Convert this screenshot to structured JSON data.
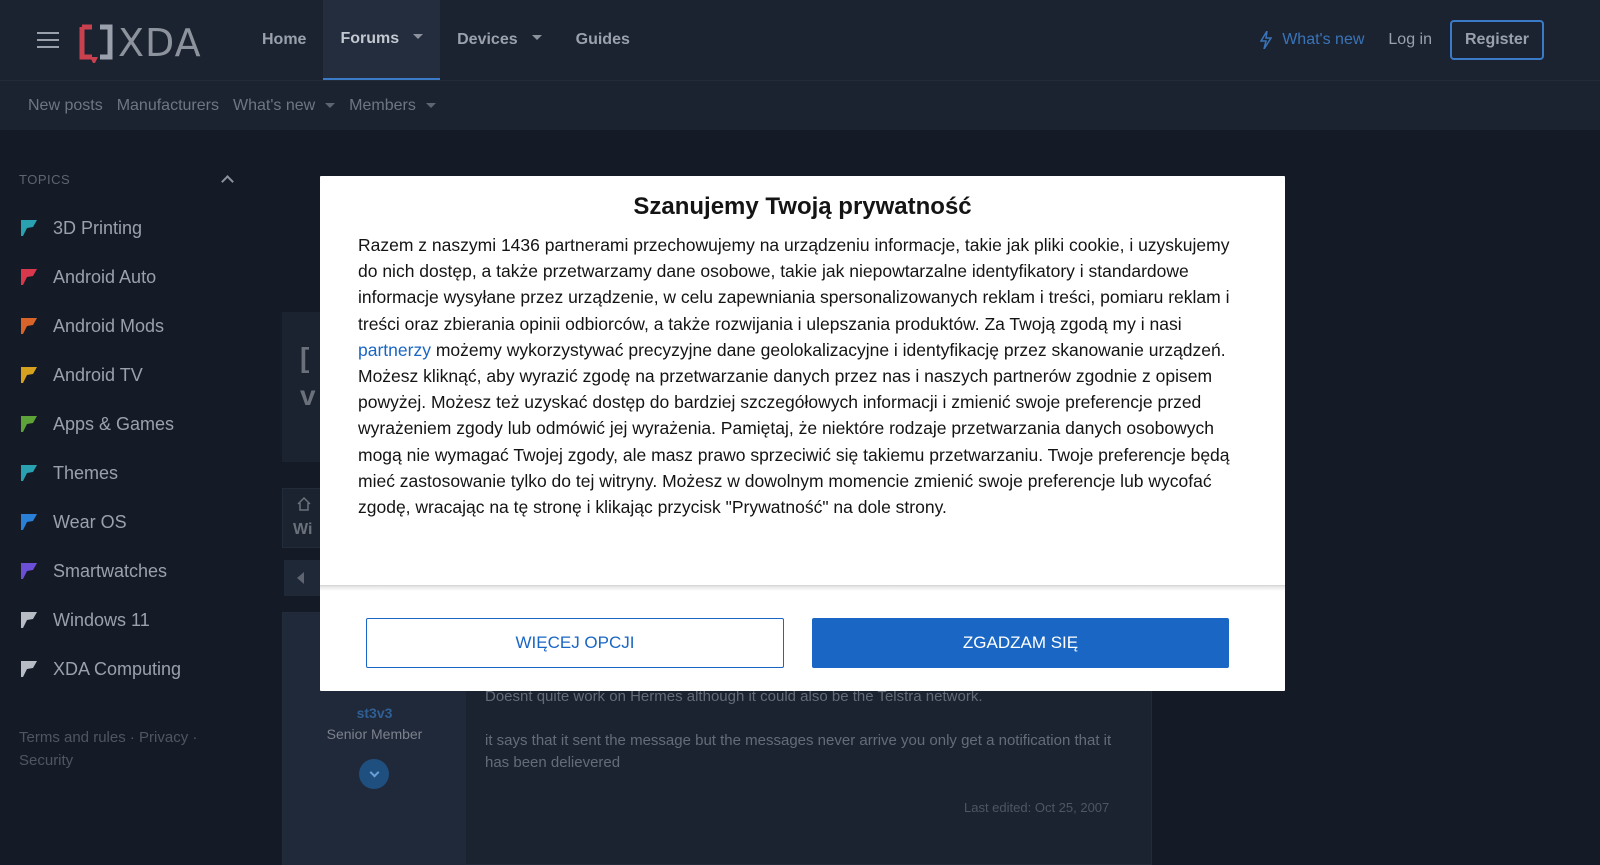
{
  "header": {
    "logo_text": "XDA",
    "nav": [
      {
        "label": "Home"
      },
      {
        "label": "Forums"
      },
      {
        "label": "Devices"
      },
      {
        "label": "Guides"
      }
    ],
    "whats_new": "What's new",
    "login": "Log in",
    "register": "Register"
  },
  "subnav": {
    "items": [
      {
        "label": "New posts"
      },
      {
        "label": "Manufacturers"
      },
      {
        "label": "What's new"
      },
      {
        "label": "Members"
      }
    ]
  },
  "sidebar": {
    "heading": "TOPICS",
    "items": [
      {
        "label": "3D Printing",
        "color": "#2aa1b0"
      },
      {
        "label": "Android Auto",
        "color": "#d8384b"
      },
      {
        "label": "Android Mods",
        "color": "#d9642a"
      },
      {
        "label": "Android TV",
        "color": "#d5a11f"
      },
      {
        "label": "Apps & Games",
        "color": "#5ea337"
      },
      {
        "label": "Themes",
        "color": "#2aa1b0"
      },
      {
        "label": "Wear OS",
        "color": "#2a7fd6"
      },
      {
        "label": "Smartwatches",
        "color": "#6b4fd6"
      },
      {
        "label": "Windows 11",
        "color": "#b8bcc4"
      },
      {
        "label": "XDA Computing",
        "color": "#b8bcc4"
      }
    ],
    "footer": "Terms and rules · Privacy · Security"
  },
  "thread": {
    "title_fragment_1": "[",
    "title_fragment_2": "v",
    "crumb_fragment": "Wi"
  },
  "post": {
    "username": "st3v3",
    "user_title": "Senior Member",
    "paragraph_1": "Doesnt quite work on Hermes although it could also be the Telstra network.",
    "paragraph_2": "it says that it sent the message but the messages never arrive you only get a notification that it has been delievered",
    "last_edited": "Last edited: Oct 25, 2007"
  },
  "consent": {
    "title": "Szanujemy Twoją prywatność",
    "body_part_1": "Razem z naszymi 1436 partnerami przechowujemy na urządzeniu informacje, takie jak pliki cookie, i uzyskujemy do nich dostęp, a także przetwarzamy dane osobowe, takie jak niepowtarzalne identyfikatory i standardowe informacje wysyłane przez urządzenie, w celu zapewniania spersonalizowanych reklam i treści, pomiaru reklam i treści oraz zbierania opinii odbiorców, a także rozwijania i ulepszania produktów. Za Twoją zgodą my i nasi ",
    "partners_link": "partnerzy",
    "body_part_2": " możemy wykorzystywać precyzyjne dane geolokalizacyjne i identyfikację przez skanowanie urządzeń. Możesz kliknąć, aby wyrazić zgodę na przetwarzanie danych przez nas i naszych partnerów zgodnie z opisem powyżej. Możesz też uzyskać dostęp do bardziej szczegółowych informacji i zmienić swoje preferencje przed wyrażeniem zgody lub odmówić jej wyrażenia. Pamiętaj, że niektóre rodzaje przetwarzania danych osobowych mogą nie wymagać Twojej zgody, ale masz prawo sprzeciwić się takiemu przetwarzaniu. Twoje preferencje będą mieć zastosowanie tylko do tej witryny. Możesz w dowolnym momencie zmienić swoje preferencje lub wycofać zgodę, wracając na tę stronę i klikając przycisk \"Prywatność\" na dole strony.",
    "more_options": "WIĘCEJ OPCJI",
    "agree": "ZGADZAM SIĘ"
  },
  "colors": {
    "accent": "#1a66c4",
    "header_bg": "#1b2331",
    "content_bg": "#141b27"
  }
}
